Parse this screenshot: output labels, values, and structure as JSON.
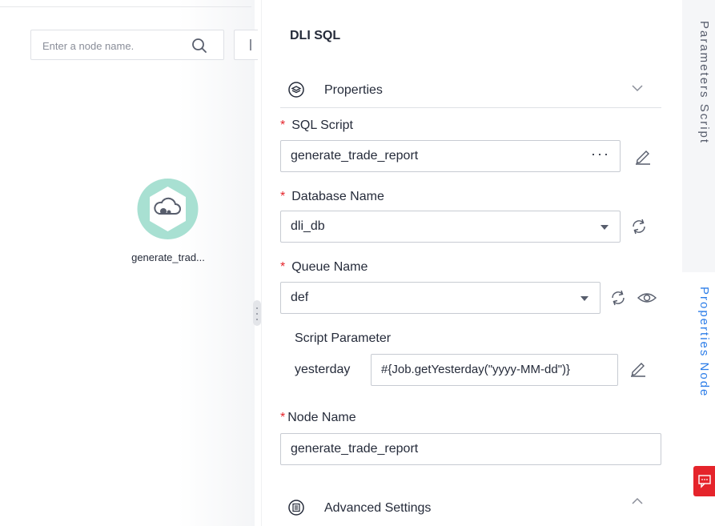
{
  "canvas": {
    "search_placeholder": "Enter a node name.",
    "node_label": "generate_trad..."
  },
  "panel": {
    "title": "DLI SQL",
    "properties_section": "Properties",
    "sql_script": {
      "label": "SQL Script",
      "value": "generate_trade_report",
      "more": "···"
    },
    "database_name": {
      "label": "Database Name",
      "value": "dli_db"
    },
    "queue_name": {
      "label": "Queue Name",
      "value": "def"
    },
    "script_parameter": {
      "label": "Script Parameter",
      "name": "yesterday",
      "value": "#{Job.getYesterday(\"yyyy-MM-dd\")}"
    },
    "node_name": {
      "label": "Node Name",
      "value": "generate_trade_report"
    },
    "advanced_section": "Advanced Settings",
    "required_mark": "*"
  },
  "side_tabs": {
    "parameters": "Parameters Script",
    "properties": "Properties Node"
  },
  "colors": {
    "accent": "#2c7de8",
    "required": "#e5242b",
    "node_ring": "#a8e0d2",
    "feedback": "#e5242b"
  },
  "icons": {
    "search": "search-icon",
    "layers": "layers-icon",
    "chevron_down": "chevron-down-icon",
    "chevron_up": "chevron-up-icon",
    "edit": "edit-icon",
    "refresh": "refresh-icon",
    "view": "eye-icon",
    "settings": "advanced-settings-icon",
    "feedback": "feedback-icon"
  }
}
